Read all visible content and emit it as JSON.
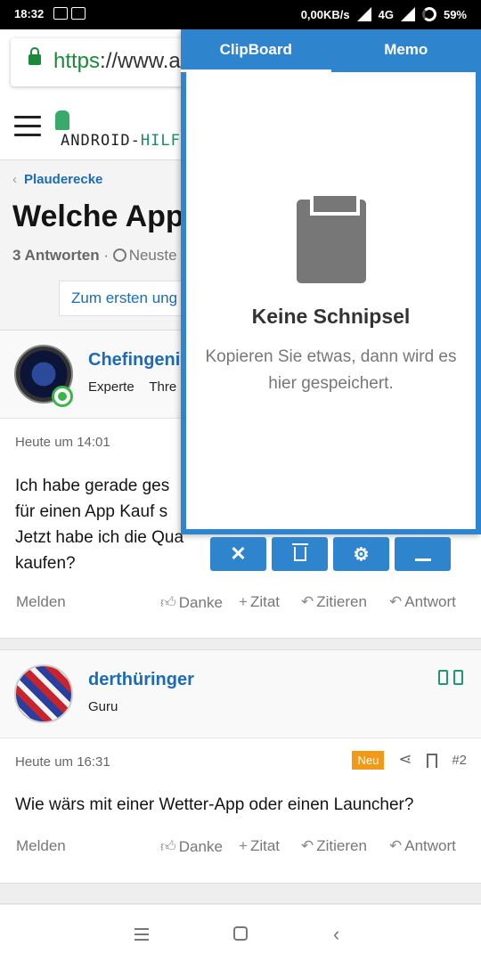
{
  "status_bar": {
    "time": "18:32",
    "network_speed": "0,00KB/s",
    "network_type": "4G",
    "battery": "59%"
  },
  "browser": {
    "url_scheme": "https",
    "url_rest": "://www.ar",
    "icons": [
      "lock-icon"
    ]
  },
  "site": {
    "logo_text_a": "ANDROID-",
    "logo_text_b": "HILFE",
    "icons": [
      "menu-icon",
      "android-logo-icon"
    ]
  },
  "thread": {
    "breadcrumb": "Plauderecke",
    "title": "Welche App",
    "replies": "3 Antworten",
    "meta_sep": " · ",
    "sort": "Neuste",
    "first_unread": "Zum ersten ung"
  },
  "posts": [
    {
      "username": "Chefingenie",
      "role": "Experte",
      "role_extra": "Thre",
      "time": "Heute um 14:01",
      "body": "Ich habe gerade ges\nfür einen App Kauf s\nJetzt habe ich die Qua\nkaufen?",
      "report": "Melden"
    },
    {
      "username": "derthüringer",
      "role": "Guru",
      "time": "Heute um 16:31",
      "badge": "Neu",
      "number": "#2",
      "body": "Wie wärs mit einer Wetter-App oder einen Launcher?",
      "report": "Melden"
    }
  ],
  "actions": {
    "thanks": "Danke",
    "quote": "Zitat",
    "cite": "Zitieren",
    "reply": "Antwort"
  },
  "clipboard": {
    "tabs": [
      "ClipBoard",
      "Memo"
    ],
    "active_tab": "ClipBoard",
    "empty_title": "Keine Schnipsel",
    "empty_desc": "Kopieren Sie etwas, dann wird es hier gespeichert.",
    "accent_color": "#2f85cd",
    "buttons": [
      "close-icon",
      "trash-icon",
      "gear-icon",
      "minimize-icon"
    ]
  },
  "nav": {
    "icons": [
      "nav-menu-icon",
      "nav-home-icon",
      "nav-back-icon"
    ]
  }
}
